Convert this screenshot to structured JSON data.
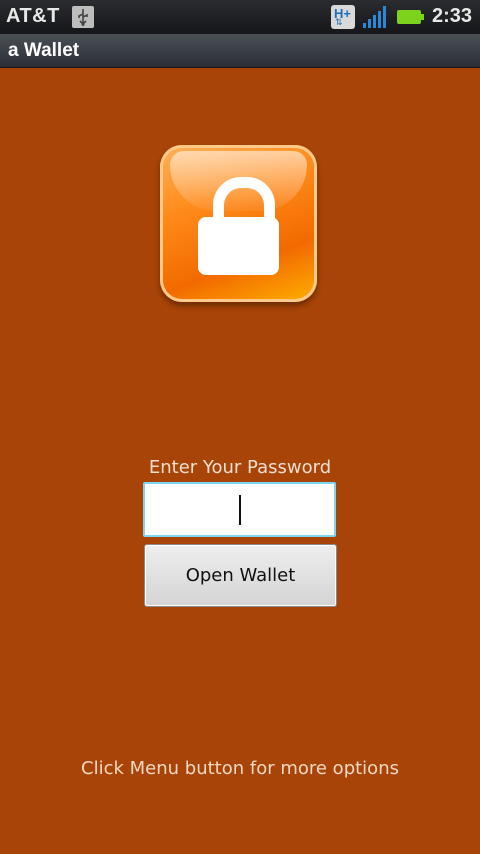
{
  "status_bar": {
    "carrier": "AT&T",
    "network_badge": "H+",
    "time": "2:33",
    "icons": [
      "usb-icon",
      "hplus-network-icon",
      "signal-icon",
      "battery-icon"
    ],
    "colors": {
      "battery": "#7dd31c",
      "signal": "#2b88d8"
    }
  },
  "title_bar": {
    "title": "a Wallet"
  },
  "lock_icon": {
    "name": "lock-icon",
    "color": "#ff8a1a"
  },
  "login": {
    "label": "Enter Your Password",
    "password_value": "",
    "open_button": "Open Wallet"
  },
  "footer": {
    "hint": "Click Menu button for more options"
  },
  "colors": {
    "background": "#a84407",
    "input_border": "#7fd6f2"
  }
}
